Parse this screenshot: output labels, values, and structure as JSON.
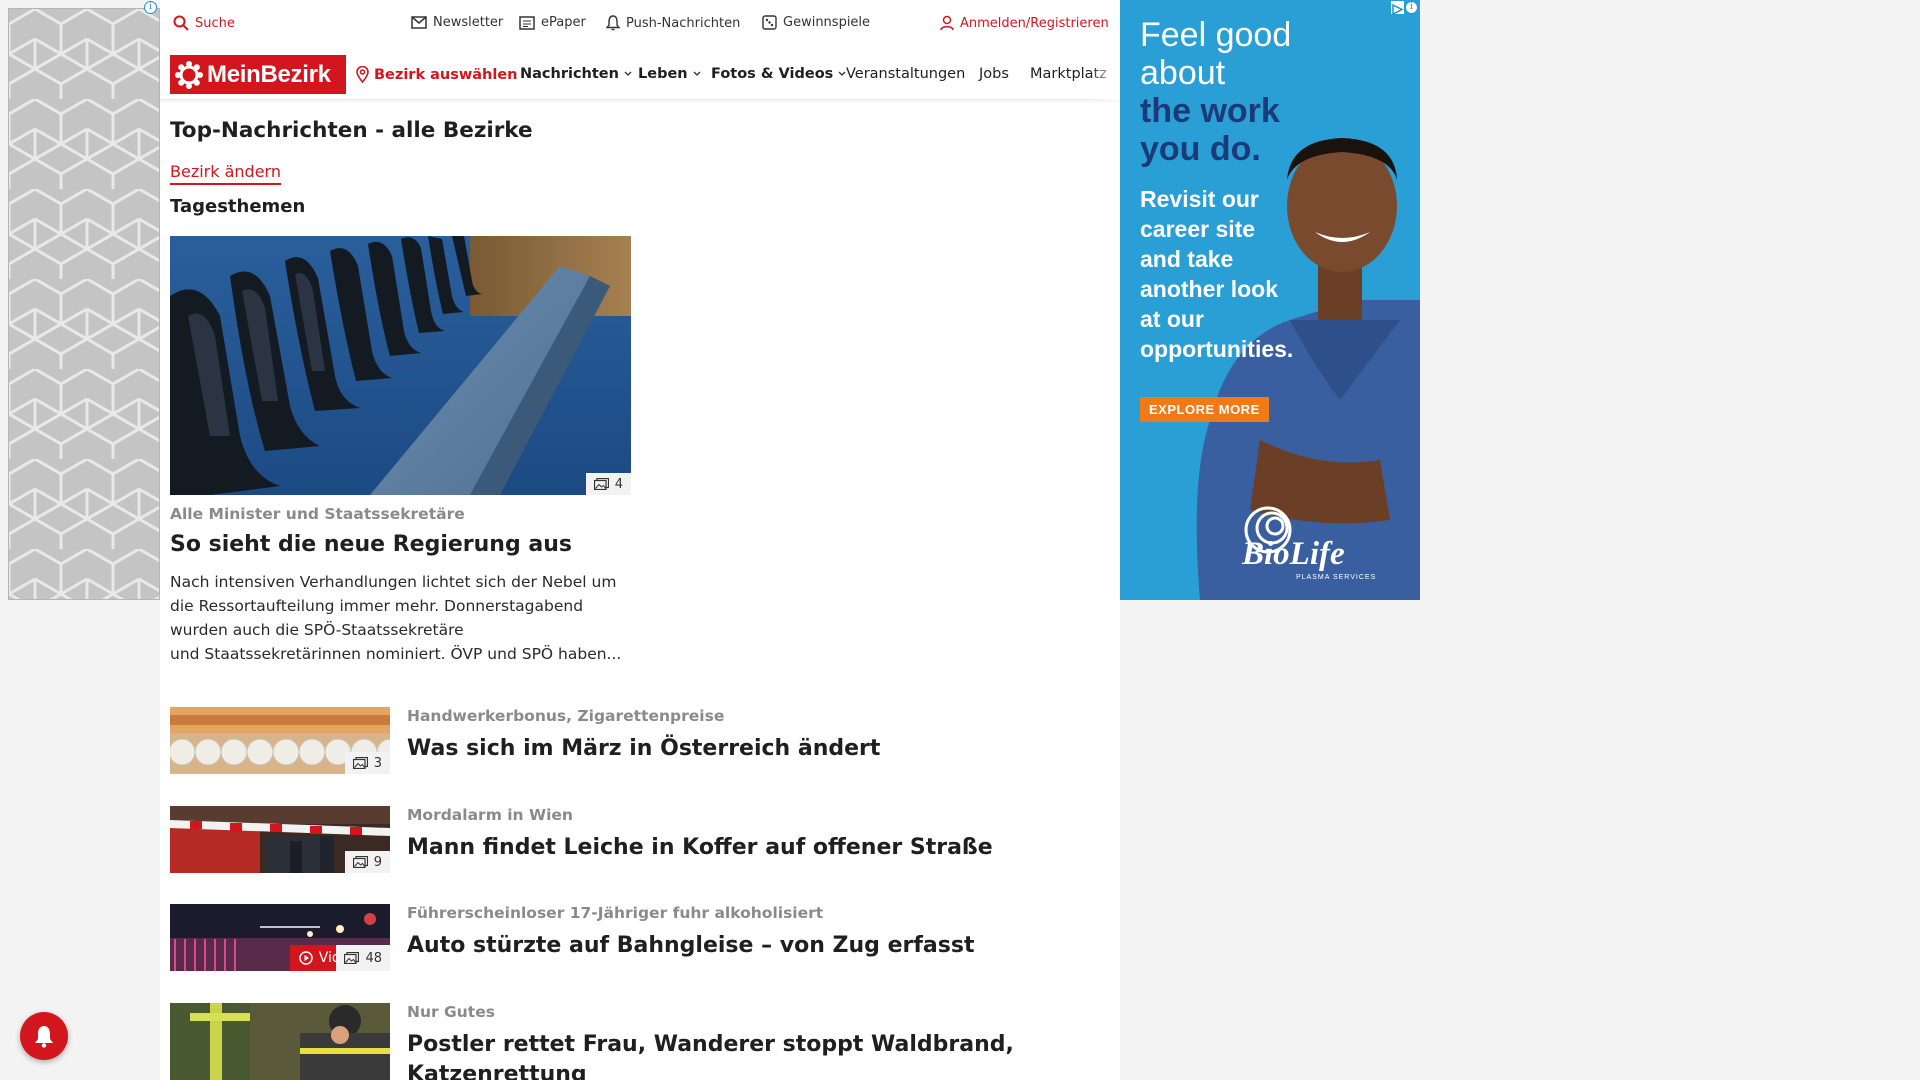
{
  "topbar": {
    "search": "Suche",
    "newsletter": "Newsletter",
    "epaper": "ePaper",
    "push": "Push-Nachrichten",
    "contests": "Gewinnspiele",
    "login": "Anmelden/Registrieren"
  },
  "nav": {
    "logo": "MeinBezirk",
    "select_district": "Bezirk auswählen",
    "items": [
      "Nachrichten",
      "Leben",
      "Fotos & Videos",
      "Veranstaltungen",
      "Jobs",
      "Marktplatz"
    ]
  },
  "page": {
    "title": "Top-Nachrichten - alle Bezirke",
    "change_district": "Bezirk ändern",
    "section": "Tagesthemen"
  },
  "hero": {
    "image_count": "4",
    "kicker": "Alle Minister und Staatssekretäre",
    "title": "So sieht die neue Regierung aus",
    "teaser_lines": [
      "Nach intensiven Verhandlungen lichtet sich der Nebel um",
      "die Ressortaufteilung immer mehr. Donnerstagabend",
      "wurden auch die SPÖ-Staatssekretäre",
      "und Staatssekretärinnen nominiert. ÖVP und SPÖ haben..."
    ]
  },
  "articles": [
    {
      "kicker": "Handwerkerbonus, Zigarettenpreise",
      "title": "Was sich im März in Österreich ändert",
      "image_count": "3"
    },
    {
      "kicker": "Mordalarm in Wien",
      "title": "Mann findet Leiche in Koffer auf offener Straße",
      "image_count": "9"
    },
    {
      "kicker": "Führerscheinloser 17-Jähriger fuhr alkoholisiert",
      "title": "Auto stürzte auf Bahngleise – von Zug erfasst",
      "image_count": "48",
      "video_label": "Video"
    },
    {
      "kicker": "Nur Gutes",
      "title": "Postler rettet Frau, Wanderer stoppt Waldbrand,",
      "title_line2": "Katzenrettung"
    }
  ],
  "right_ad": {
    "headline_light_1": "Feel good",
    "headline_light_2": "about",
    "headline_dark_1": "the work",
    "headline_dark_2": "you do.",
    "body_lines": [
      "Revisit our",
      "career site",
      "and take",
      "another look",
      "at our",
      "opportunities."
    ],
    "button": "EXPLORE MORE",
    "brand": "BioLife",
    "brand_sub": "PLASMA SERVICES"
  },
  "colors": {
    "brand_red": "#d3161d",
    "ad_blue": "#2a9fd6",
    "ad_orange": "#f07a16",
    "kicker_gray": "#8a8a8a"
  }
}
